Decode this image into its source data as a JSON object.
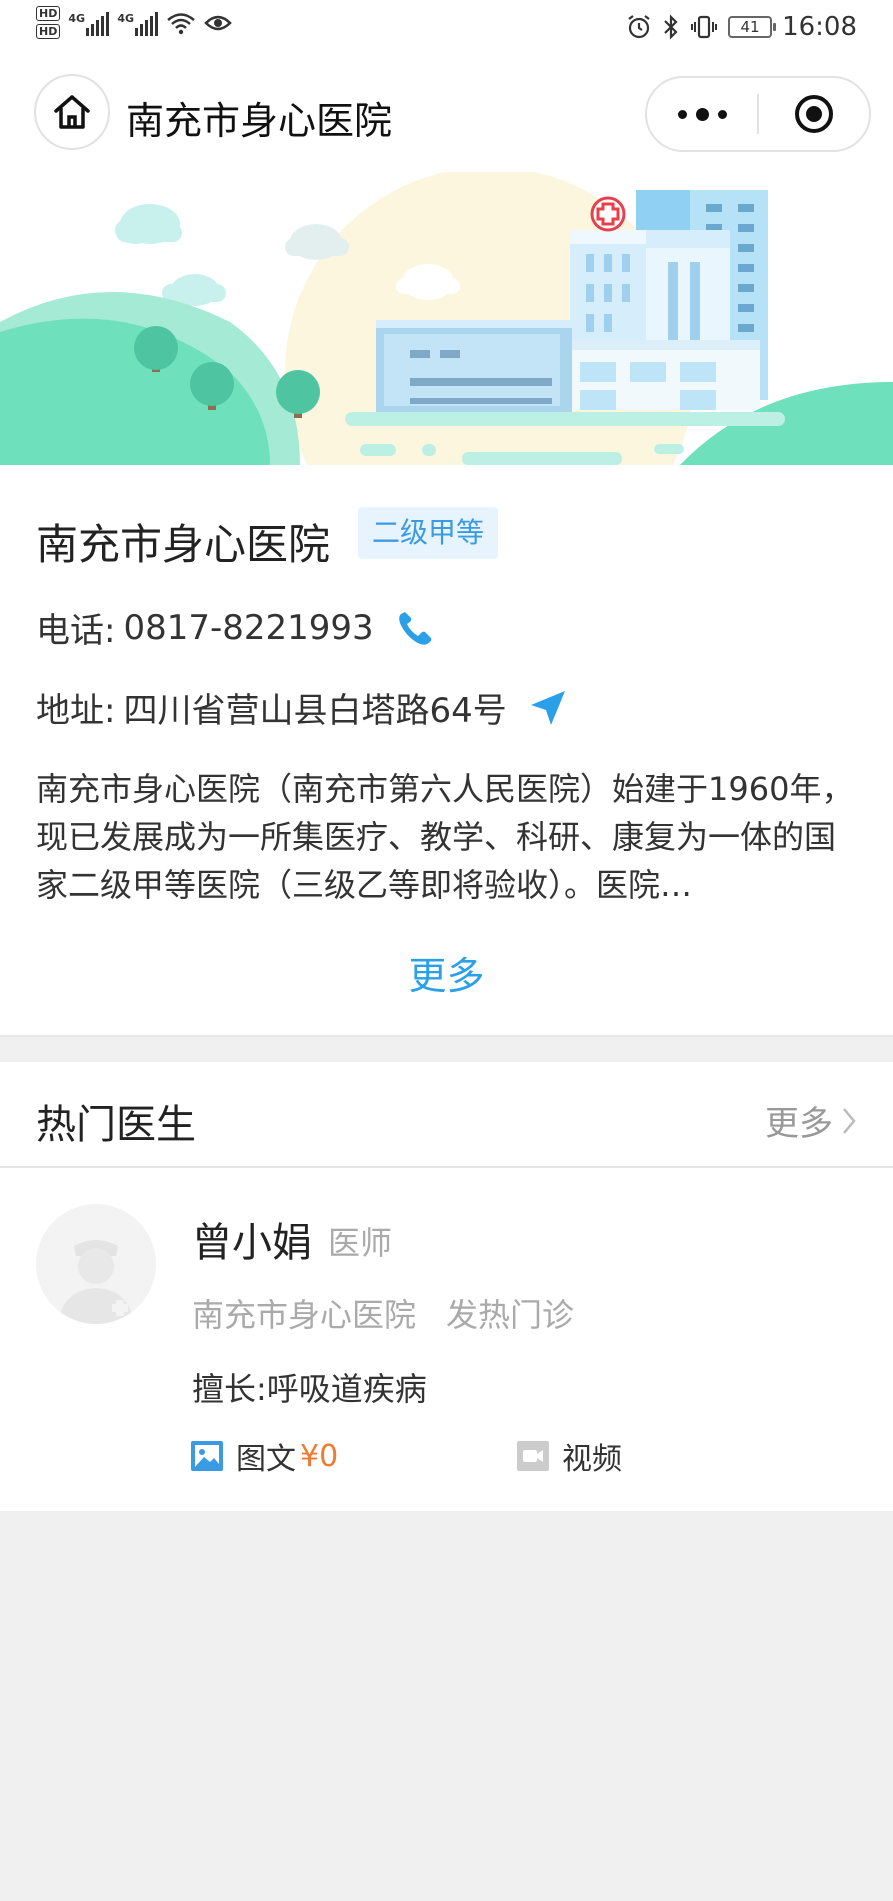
{
  "status_bar": {
    "hd1": "HD",
    "hd2": "HD",
    "net1": "4G",
    "net2": "4G",
    "battery": "41",
    "time": "16:08"
  },
  "nav": {
    "title": "南充市身心医院"
  },
  "hospital": {
    "name": "南充市身心医院",
    "grade": "二级甲等",
    "phone_label": "电话:",
    "phone": "0817-8221993",
    "address_label": "地址:",
    "address": "四川省营山县白塔路64号",
    "description": "南充市身心医院（南充市第六人民医院）始建于1960年，现已发展成为一所集医疗、教学、科研、康复为一体的国家二级甲等医院（三级乙等即将验收）。医院…",
    "more": "更多"
  },
  "hot_doctors": {
    "title": "热门医生",
    "more": "更多",
    "doctors": [
      {
        "name": "曾小娟",
        "title": "医师",
        "hospital": "南充市身心医院",
        "department": "发热门诊",
        "skill": "擅长:呼吸道疾病",
        "services": [
          {
            "label": "图文",
            "price": "¥0",
            "icon": "image-icon",
            "color": "#3a9be4"
          },
          {
            "label": "视频",
            "price": "",
            "icon": "video-icon",
            "color": "#bbbbbb"
          }
        ]
      }
    ]
  },
  "colors": {
    "accent": "#2aa0e8",
    "price": "#f07a32",
    "banner_green": "#6ee0bc"
  }
}
